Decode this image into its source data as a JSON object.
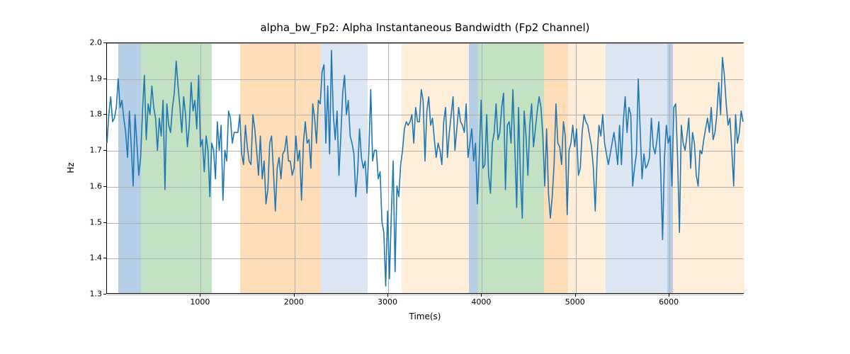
{
  "chart_data": {
    "type": "line",
    "title": "alpha_bw_Fp2: Alpha Instantaneous Bandwidth (Fp2 Channel)",
    "xlabel": "Time(s)",
    "ylabel": "Hz",
    "xlim": [
      0,
      6800
    ],
    "ylim": [
      1.3,
      2.0
    ],
    "xticks": [
      1000,
      2000,
      3000,
      4000,
      5000,
      6000
    ],
    "yticks": [
      1.3,
      1.4,
      1.5,
      1.6,
      1.7,
      1.8,
      1.9,
      2.0
    ],
    "bands": [
      {
        "start": 120,
        "end": 360,
        "color": "#b6cee6"
      },
      {
        "start": 360,
        "end": 1120,
        "color": "#c3e1c3"
      },
      {
        "start": 1420,
        "end": 2280,
        "color": "#ffddb8"
      },
      {
        "start": 2280,
        "end": 2780,
        "color": "#dce7f3"
      },
      {
        "start": 3140,
        "end": 3860,
        "color": "#ffeed9"
      },
      {
        "start": 3860,
        "end": 3960,
        "color": "#b6cee6"
      },
      {
        "start": 3960,
        "end": 4660,
        "color": "#c3e1c3"
      },
      {
        "start": 4660,
        "end": 4920,
        "color": "#ffddb8"
      },
      {
        "start": 4920,
        "end": 5320,
        "color": "#ffeed9"
      },
      {
        "start": 5320,
        "end": 5980,
        "color": "#dce7f3"
      },
      {
        "start": 5980,
        "end": 6040,
        "color": "#b6cee6"
      },
      {
        "start": 6040,
        "end": 6800,
        "color": "#ffeed9"
      }
    ],
    "series": [
      {
        "name": "alpha_bw_Fp2",
        "x": [
          0,
          20,
          40,
          60,
          80,
          100,
          120,
          140,
          160,
          180,
          200,
          220,
          240,
          260,
          280,
          300,
          320,
          340,
          360,
          380,
          400,
          420,
          440,
          460,
          480,
          500,
          520,
          540,
          560,
          580,
          600,
          620,
          640,
          660,
          680,
          700,
          720,
          740,
          760,
          780,
          800,
          820,
          840,
          860,
          880,
          900,
          920,
          940,
          960,
          980,
          1000,
          1020,
          1040,
          1060,
          1080,
          1100,
          1120,
          1140,
          1160,
          1180,
          1200,
          1220,
          1240,
          1260,
          1280,
          1300,
          1320,
          1340,
          1360,
          1380,
          1400,
          1420,
          1440,
          1460,
          1480,
          1500,
          1520,
          1540,
          1560,
          1580,
          1600,
          1620,
          1640,
          1660,
          1680,
          1700,
          1720,
          1740,
          1760,
          1780,
          1800,
          1820,
          1840,
          1860,
          1880,
          1900,
          1920,
          1940,
          1960,
          1980,
          2000,
          2020,
          2040,
          2060,
          2080,
          2100,
          2120,
          2140,
          2160,
          2180,
          2200,
          2220,
          2240,
          2260,
          2280,
          2300,
          2320,
          2340,
          2360,
          2380,
          2400,
          2420,
          2440,
          2460,
          2480,
          2500,
          2520,
          2540,
          2560,
          2580,
          2600,
          2620,
          2640,
          2660,
          2680,
          2700,
          2720,
          2740,
          2760,
          2780,
          2800,
          2820,
          2840,
          2860,
          2880,
          2900,
          2920,
          2940,
          2960,
          2980,
          3000,
          3020,
          3040,
          3060,
          3080,
          3100,
          3120,
          3140,
          3160,
          3180,
          3200,
          3220,
          3240,
          3260,
          3280,
          3300,
          3320,
          3340,
          3360,
          3380,
          3400,
          3420,
          3440,
          3460,
          3480,
          3500,
          3520,
          3540,
          3560,
          3580,
          3600,
          3620,
          3640,
          3660,
          3680,
          3700,
          3720,
          3740,
          3760,
          3780,
          3800,
          3820,
          3840,
          3860,
          3880,
          3900,
          3920,
          3940,
          3960,
          3980,
          4000,
          4020,
          4040,
          4060,
          4080,
          4100,
          4120,
          4140,
          4160,
          4180,
          4200,
          4220,
          4240,
          4260,
          4280,
          4300,
          4320,
          4340,
          4360,
          4380,
          4400,
          4420,
          4440,
          4460,
          4480,
          4500,
          4520,
          4540,
          4560,
          4580,
          4600,
          4620,
          4640,
          4660,
          4680,
          4700,
          4720,
          4740,
          4760,
          4780,
          4800,
          4820,
          4840,
          4860,
          4880,
          4900,
          4920,
          4940,
          4960,
          4980,
          5000,
          5020,
          5040,
          5060,
          5080,
          5100,
          5120,
          5140,
          5160,
          5180,
          5200,
          5220,
          5240,
          5260,
          5280,
          5300,
          5320,
          5340,
          5360,
          5380,
          5400,
          5420,
          5440,
          5460,
          5480,
          5500,
          5520,
          5540,
          5560,
          5580,
          5600,
          5620,
          5640,
          5660,
          5680,
          5700,
          5720,
          5740,
          5760,
          5780,
          5800,
          5820,
          5840,
          5860,
          5880,
          5900,
          5920,
          5940,
          5960,
          5980,
          6000,
          6020,
          6040,
          6060,
          6080,
          6100,
          6120,
          6140,
          6160,
          6180,
          6200,
          6220,
          6240,
          6260,
          6280,
          6300,
          6320,
          6340,
          6360,
          6380,
          6400,
          6420,
          6440,
          6460,
          6480,
          6500,
          6520,
          6540,
          6560,
          6580,
          6600,
          6620,
          6640,
          6660,
          6680,
          6700,
          6720,
          6740,
          6760,
          6780,
          6800
        ],
        "values": [
          1.72,
          1.8,
          1.85,
          1.78,
          1.79,
          1.82,
          1.9,
          1.82,
          1.84,
          1.79,
          1.75,
          1.68,
          1.81,
          1.71,
          1.6,
          1.8,
          1.72,
          1.63,
          1.68,
          1.81,
          1.91,
          1.73,
          1.83,
          1.8,
          1.88,
          1.82,
          1.79,
          1.7,
          1.79,
          1.74,
          1.84,
          1.59,
          1.83,
          1.77,
          1.75,
          1.82,
          1.86,
          1.95,
          1.88,
          1.82,
          1.75,
          1.85,
          1.8,
          1.71,
          1.77,
          1.89,
          1.81,
          1.84,
          1.76,
          1.91,
          1.71,
          1.73,
          1.64,
          1.74,
          1.7,
          1.57,
          1.72,
          1.7,
          1.62,
          1.78,
          1.7,
          1.77,
          1.56,
          1.7,
          1.67,
          1.81,
          1.79,
          1.72,
          1.75,
          1.75,
          1.75,
          1.8,
          1.69,
          1.66,
          1.77,
          1.71,
          1.67,
          1.66,
          1.8,
          1.76,
          1.7,
          1.63,
          1.74,
          1.62,
          1.67,
          1.55,
          1.59,
          1.72,
          1.74,
          1.64,
          1.53,
          1.65,
          1.68,
          1.62,
          1.69,
          1.7,
          1.74,
          1.67,
          1.67,
          1.63,
          1.65,
          1.74,
          1.67,
          1.7,
          1.56,
          1.72,
          1.78,
          1.72,
          1.73,
          1.65,
          1.83,
          1.79,
          1.72,
          1.84,
          1.83,
          1.92,
          1.94,
          1.72,
          1.88,
          1.69,
          1.98,
          1.8,
          1.73,
          1.81,
          1.63,
          1.74,
          1.86,
          1.91,
          1.8,
          1.84,
          1.74,
          1.72,
          1.69,
          1.57,
          1.64,
          1.76,
          1.68,
          1.65,
          1.67,
          1.58,
          1.7,
          1.87,
          1.67,
          1.7,
          1.7,
          1.62,
          1.64,
          1.5,
          1.47,
          1.32,
          1.53,
          1.34,
          1.52,
          1.67,
          1.36,
          1.6,
          1.57,
          1.66,
          1.7,
          1.76,
          1.78,
          1.77,
          1.78,
          1.8,
          1.72,
          1.82,
          1.78,
          1.78,
          1.87,
          1.84,
          1.67,
          1.81,
          1.85,
          1.77,
          1.79,
          1.73,
          1.68,
          1.72,
          1.7,
          1.66,
          1.78,
          1.82,
          1.68,
          1.75,
          1.8,
          1.85,
          1.7,
          1.76,
          1.82,
          1.78,
          1.77,
          1.75,
          1.83,
          1.68,
          1.72,
          1.76,
          1.67,
          1.72,
          1.55,
          1.68,
          1.84,
          1.65,
          1.66,
          1.8,
          1.63,
          1.58,
          1.72,
          1.75,
          1.83,
          1.73,
          1.75,
          1.82,
          1.86,
          1.59,
          1.77,
          1.78,
          1.72,
          1.87,
          1.71,
          1.54,
          1.82,
          1.63,
          1.51,
          1.81,
          1.74,
          1.63,
          1.77,
          1.83,
          1.71,
          1.76,
          1.81,
          1.85,
          1.82,
          1.74,
          1.6,
          1.76,
          1.58,
          1.51,
          1.57,
          1.66,
          1.83,
          1.72,
          1.71,
          1.66,
          1.78,
          1.74,
          1.52,
          1.7,
          1.72,
          1.77,
          1.71,
          1.76,
          1.63,
          1.65,
          1.75,
          1.8,
          1.78,
          1.77,
          1.74,
          1.71,
          1.65,
          1.53,
          1.68,
          1.77,
          1.74,
          1.8,
          1.72,
          1.69,
          1.66,
          1.69,
          1.72,
          1.75,
          1.71,
          1.66,
          1.77,
          1.66,
          1.78,
          1.85,
          1.75,
          1.82,
          1.8,
          1.6,
          1.65,
          1.69,
          1.9,
          1.76,
          1.62,
          1.69,
          1.65,
          1.66,
          1.68,
          1.79,
          1.71,
          1.69,
          1.73,
          1.78,
          1.64,
          1.45,
          1.68,
          1.77,
          1.72,
          1.74,
          1.6,
          1.82,
          1.83,
          1.68,
          1.47,
          1.77,
          1.72,
          1.7,
          1.74,
          1.79,
          1.65,
          1.75,
          1.72,
          1.63,
          1.6,
          1.7,
          1.69,
          1.73,
          1.76,
          1.79,
          1.75,
          1.82,
          1.73,
          1.75,
          1.8,
          1.89,
          1.8,
          1.96,
          1.91,
          1.83,
          1.77,
          1.79,
          1.7,
          1.6,
          1.8,
          1.72,
          1.75,
          1.81,
          1.78
        ]
      }
    ]
  }
}
